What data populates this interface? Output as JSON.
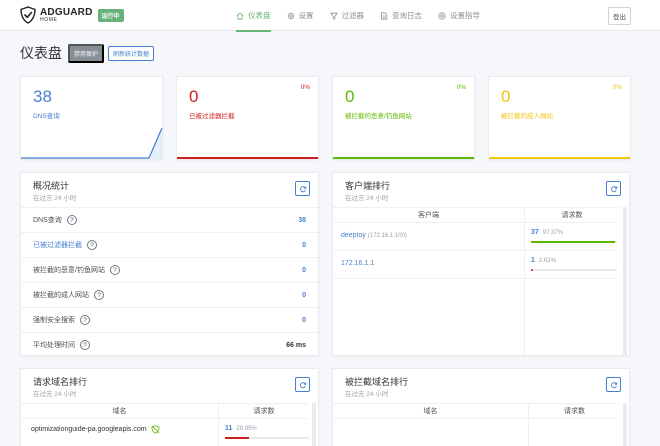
{
  "header": {
    "brand": "ADGUARD",
    "brand_sub": "HOME",
    "status_badge": "运行中",
    "nav": [
      {
        "label": "仪表盘",
        "icon": "dashboard-icon"
      },
      {
        "label": "设置",
        "icon": "gear-icon"
      },
      {
        "label": "过滤器",
        "icon": "filter-icon"
      },
      {
        "label": "查询日志",
        "icon": "log-icon"
      },
      {
        "label": "设置指导",
        "icon": "help-circle-icon"
      }
    ],
    "logout": "登出"
  },
  "page": {
    "title": "仪表盘",
    "disable_protection": "禁用保护",
    "refresh_stats": "刷新统计数据"
  },
  "stats": [
    {
      "value": "38",
      "label": "DNS查询",
      "percent": "",
      "color": "#467fcf"
    },
    {
      "value": "0",
      "label": "已被过滤器拦截",
      "percent": "0%",
      "color": "#cd201f"
    },
    {
      "value": "0",
      "label": "被拦截的恶意/钓鱼网站",
      "percent": "0%",
      "color": "#5eba00"
    },
    {
      "value": "0",
      "label": "被拦截的成人网站",
      "percent": "0%",
      "color": "#f1c40f"
    }
  ],
  "overview": {
    "title": "概况统计",
    "subtitle": "在过去 24 小时",
    "rows": [
      {
        "label": "DNS查询",
        "value": "38"
      },
      {
        "label": "已被过滤器拦截",
        "value": "0"
      },
      {
        "label": "被拦截的恶意/钓鱼网站",
        "value": "0"
      },
      {
        "label": "被拦截的成人网站",
        "value": "0"
      },
      {
        "label": "强制安全搜索",
        "value": "0"
      },
      {
        "label": "平均处理时间",
        "value": "66 ms"
      }
    ]
  },
  "clients": {
    "title": "客户端排行",
    "subtitle": "在过去 24 小时",
    "col_client": "客户端",
    "col_requests": "请求数",
    "rows": [
      {
        "name": "deeptoy",
        "ip": "(172.16.1.100)",
        "count": "37",
        "percent": "97.37%",
        "fill": 0.9737
      },
      {
        "name": "172.16.1.1",
        "ip": "",
        "count": "1",
        "percent": "2.63%",
        "fill": 0.0263
      }
    ]
  },
  "top_domains": {
    "title": "请求域名排行",
    "subtitle": "在过去 24 小时",
    "col_domain": "域名",
    "col_requests": "请求数",
    "rows": [
      {
        "domain": "optimizationguide-pa.googleapis.com",
        "count": "11",
        "percent": "28.95%",
        "fill": 0.2895
      }
    ]
  },
  "blocked_domains": {
    "title": "被拦截域名排行",
    "subtitle": "在过去 24 小时",
    "col_domain": "域名",
    "col_requests": "请求数"
  }
}
